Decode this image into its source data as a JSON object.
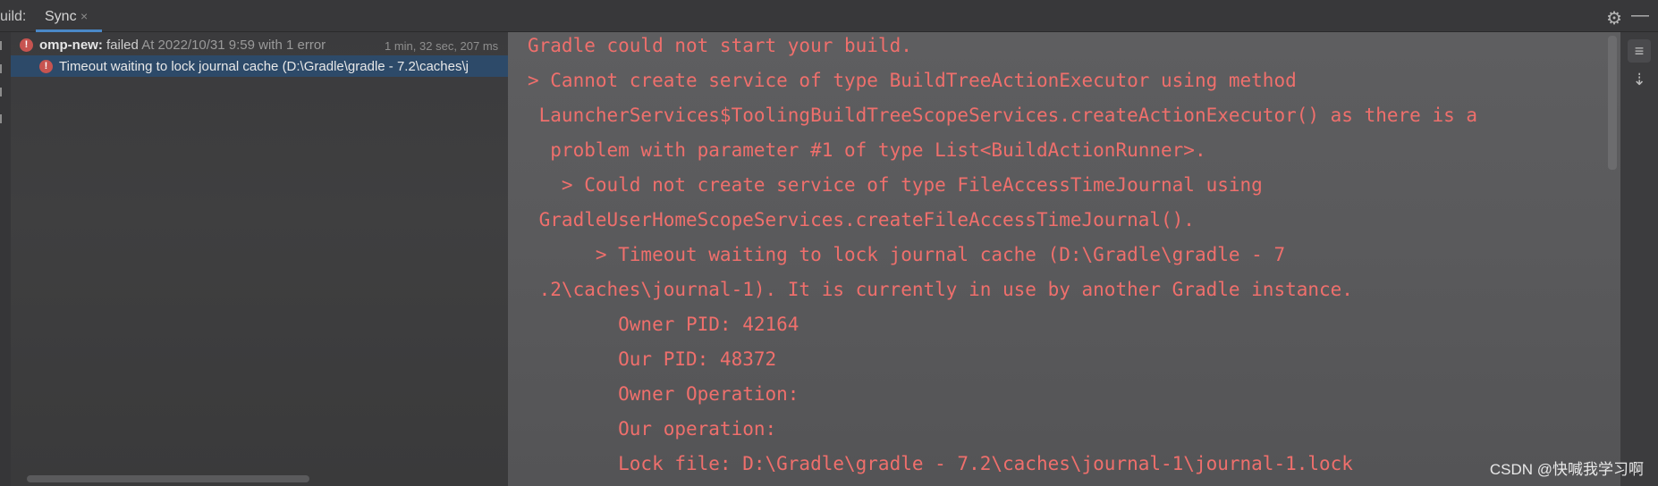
{
  "topbar": {
    "build_label": "uild:",
    "tabs": [
      {
        "label": "Sync",
        "close_icon": "×"
      }
    ],
    "gear_icon": "gear-icon",
    "minimize_icon": "minimize-icon"
  },
  "tree": {
    "rows": [
      {
        "project": "omp-new:",
        "status": "failed",
        "info": "At 2022/10/31 9:59 with 1 error",
        "duration": "1 min, 32 sec, 207 ms"
      },
      {
        "message": "Timeout waiting to lock journal cache (D:\\Gradle\\gradle - 7.2\\caches\\j"
      }
    ]
  },
  "console": {
    "lines": [
      "Gradle could not start your build.",
      "> Cannot create service of type BuildTreeActionExecutor using method",
      " LauncherServices$ToolingBuildTreeScopeServices.createActionExecutor() as there is a",
      "  problem with parameter #1 of type List<BuildActionRunner>.",
      "   > Could not create service of type FileAccessTimeJournal using",
      " GradleUserHomeScopeServices.createFileAccessTimeJournal().",
      "      > Timeout waiting to lock journal cache (D:\\Gradle\\gradle - 7",
      " .2\\caches\\journal-1). It is currently in use by another Gradle instance.",
      "        Owner PID: 42164",
      "        Our PID: 48372",
      "        Owner Operation:",
      "        Our operation:",
      "        Lock file: D:\\Gradle\\gradle - 7.2\\caches\\journal-1\\journal-1.lock"
    ]
  },
  "watermark": "CSDN @快喊我学习啊",
  "colors": {
    "error_text": "#ef6f6c",
    "selection": "#2d4a69",
    "tab_underline": "#4a88c7"
  }
}
